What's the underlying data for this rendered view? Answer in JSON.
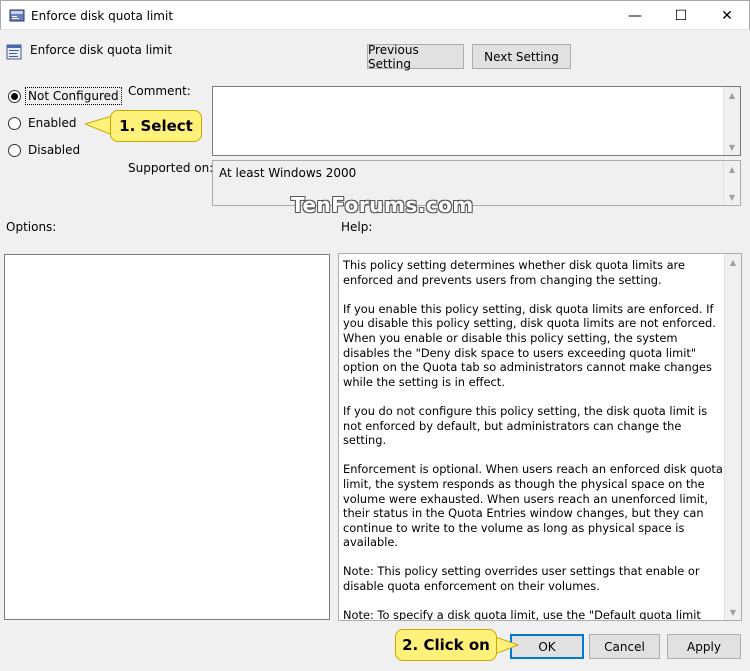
{
  "window": {
    "title": "Enforce disk quota limit",
    "controls": {
      "minimize": "—",
      "maximize": "☐",
      "close": "✕"
    }
  },
  "header": {
    "policy_name": "Enforce disk quota limit",
    "previous_button": "Previous Setting",
    "next_button": "Next Setting"
  },
  "state": {
    "options": [
      {
        "label": "Not Configured",
        "selected": true
      },
      {
        "label": "Enabled",
        "selected": false
      },
      {
        "label": "Disabled",
        "selected": false
      }
    ]
  },
  "comment": {
    "label": "Comment:",
    "value": ""
  },
  "supported": {
    "label": "Supported on:",
    "value": "At least Windows 2000"
  },
  "options_label": "Options:",
  "help_label": "Help:",
  "help_paragraphs": [
    "This policy setting determines whether disk quota limits are enforced and prevents users from changing the setting.",
    "If you enable this policy setting, disk quota limits are enforced. If you disable this policy setting, disk quota limits are not enforced. When you enable or disable this policy setting, the system disables the \"Deny disk space to users exceeding quota limit\" option on the Quota tab so administrators cannot make changes while the setting is in effect.",
    "If you do not configure this policy setting, the disk quota limit is not enforced by default, but administrators can change the setting.",
    "Enforcement is optional. When users reach an enforced disk quota limit, the system responds as though the physical space on the volume were exhausted. When users reach an unenforced limit, their status in the Quota Entries window changes, but they can continue to write to the volume as long as physical space is available.",
    "Note: This policy setting overrides user settings that enable or disable quota enforcement on their volumes.",
    "Note: To specify a disk quota limit, use the \"Default quota limit and warning level\" policy setting. Otherwise, the system uses the physical space on the volume as the quota limit."
  ],
  "footer": {
    "ok": "OK",
    "cancel": "Cancel",
    "apply": "Apply"
  },
  "annotations": {
    "step1": "1. Select",
    "step2": "2. Click on"
  },
  "watermark": "TenForums.com",
  "colors": {
    "callout_fill": "#fff17a",
    "accent": "#0078d7"
  }
}
